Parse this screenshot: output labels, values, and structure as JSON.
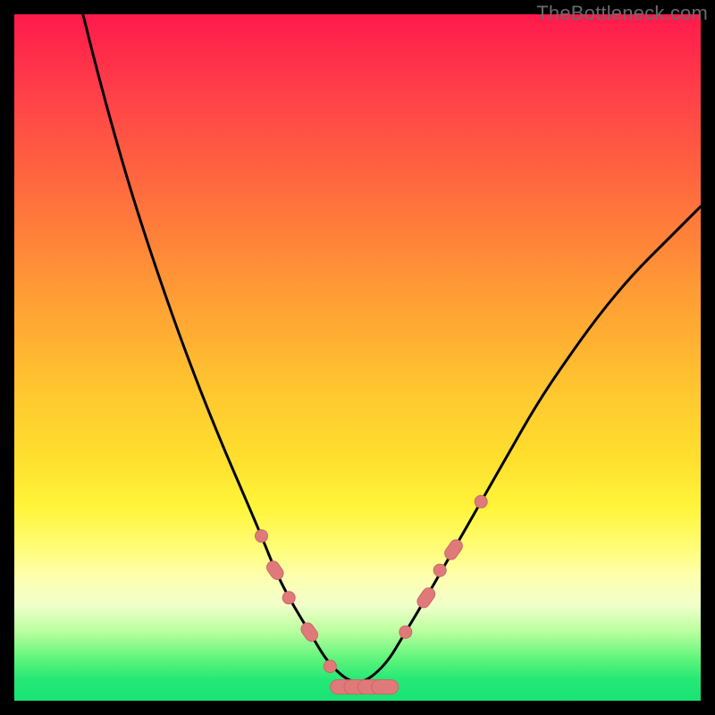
{
  "watermark": "TheBottleneck.com",
  "colors": {
    "frame": "#000000",
    "curve": "#000000",
    "markers_fill": "#e07a7a",
    "markers_stroke": "#c96868",
    "gradient_top": "#ff1a4b",
    "gradient_bottom": "#19e374"
  },
  "chart_data": {
    "type": "line",
    "title": "",
    "xlabel": "",
    "ylabel": "",
    "xlim": [
      0,
      100
    ],
    "ylim": [
      0,
      100
    ],
    "grid": false,
    "legend": false,
    "series": [
      {
        "name": "bottleneck-curve",
        "x": [
          10,
          12,
          15,
          18,
          22,
          26,
          30,
          33,
          36,
          38,
          40,
          43,
          46,
          50,
          54,
          57,
          60,
          64,
          68,
          72,
          76,
          80,
          85,
          90,
          95,
          100
        ],
        "y": [
          100,
          92,
          81,
          71,
          59,
          48,
          38,
          31,
          24,
          19,
          15,
          10,
          5,
          2,
          5,
          10,
          15,
          22,
          29,
          36,
          43,
          49,
          56,
          62,
          67,
          72
        ]
      }
    ],
    "markers": {
      "name": "highlighted-points",
      "shape": "rounded-pill",
      "left_cluster": [
        {
          "x": 36,
          "y": 24
        },
        {
          "x": 38,
          "y": 19
        },
        {
          "x": 40,
          "y": 15
        },
        {
          "x": 43,
          "y": 10
        },
        {
          "x": 46,
          "y": 5
        }
      ],
      "bottom_cluster": [
        {
          "x": 48,
          "y": 2
        },
        {
          "x": 50,
          "y": 2
        },
        {
          "x": 52,
          "y": 2
        },
        {
          "x": 54,
          "y": 2
        }
      ],
      "right_cluster": [
        {
          "x": 57,
          "y": 10
        },
        {
          "x": 60,
          "y": 15
        },
        {
          "x": 62,
          "y": 19
        },
        {
          "x": 64,
          "y": 22
        },
        {
          "x": 68,
          "y": 29
        }
      ]
    }
  }
}
